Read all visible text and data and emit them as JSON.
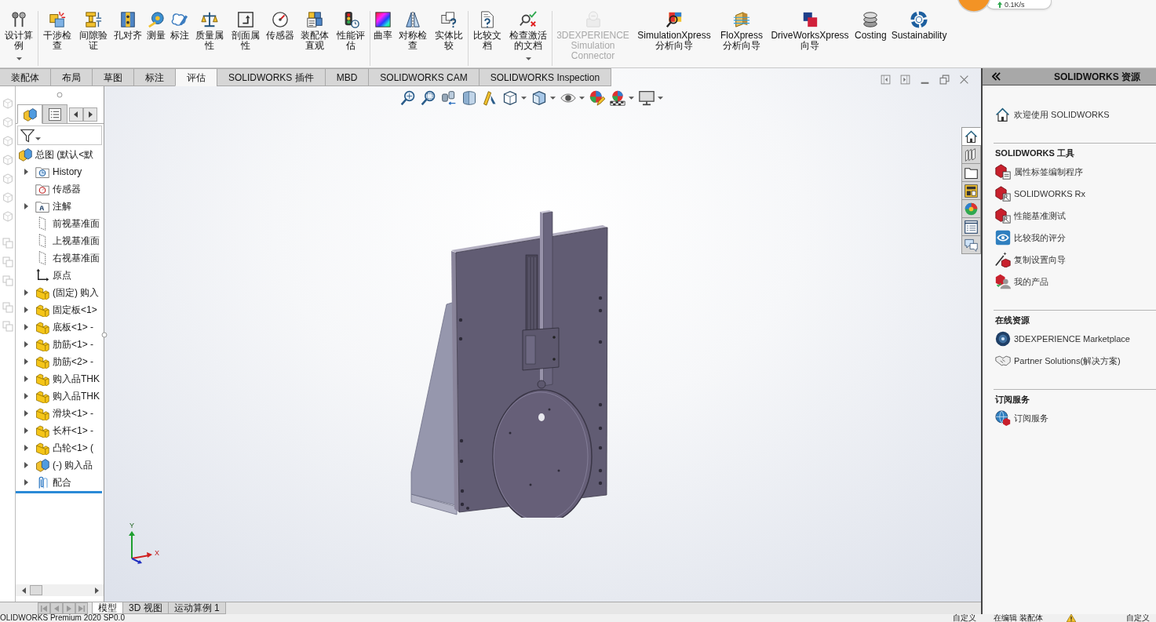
{
  "network_widget": {
    "speed": "0.1K/s"
  },
  "ribbon": {
    "groups": [
      {
        "buttons": [
          {
            "label": "设计算例",
            "dropdown": true,
            "disabled": false
          }
        ]
      },
      {
        "buttons": [
          {
            "label": "干涉检查",
            "dropdown": false,
            "disabled": false
          },
          {
            "label": "间隙验证",
            "dropdown": false,
            "disabled": false
          },
          {
            "label": "孔对齐",
            "dropdown": false,
            "disabled": false
          },
          {
            "label": "测量",
            "dropdown": false,
            "disabled": false
          },
          {
            "label": "标注",
            "dropdown": false,
            "disabled": false
          },
          {
            "label": "质量属性",
            "dropdown": false,
            "disabled": false
          },
          {
            "label": "剖面属性",
            "dropdown": false,
            "disabled": false
          },
          {
            "label": "传感器",
            "dropdown": false,
            "disabled": false
          },
          {
            "label": "装配体直观",
            "dropdown": false,
            "disabled": false
          },
          {
            "label": "性能评估",
            "dropdown": false,
            "disabled": false
          }
        ]
      },
      {
        "buttons": [
          {
            "label": "曲率",
            "dropdown": false,
            "disabled": false
          },
          {
            "label": "对称检查",
            "dropdown": false,
            "disabled": false
          },
          {
            "label": "实体比较",
            "dropdown": false,
            "disabled": false
          }
        ]
      },
      {
        "buttons": [
          {
            "label": "比较文档",
            "dropdown": false,
            "disabled": false
          },
          {
            "label": "检查激活的文档",
            "dropdown": true,
            "disabled": false
          }
        ]
      },
      {
        "buttons": [
          {
            "label": "3DEXPERIENCE Simulation Connector",
            "dropdown": false,
            "disabled": true
          },
          {
            "label": "SimulationXpress 分析向导",
            "dropdown": false,
            "disabled": false
          },
          {
            "label": "FloXpress 分析向导",
            "dropdown": false,
            "disabled": false
          },
          {
            "label": "DriveWorksXpress 向导",
            "dropdown": false,
            "disabled": false
          },
          {
            "label": "Costing",
            "dropdown": false,
            "disabled": false
          },
          {
            "label": "Sustainability",
            "dropdown": false,
            "disabled": false
          }
        ]
      }
    ]
  },
  "command_tabs": [
    {
      "label": "装配体",
      "selected": false
    },
    {
      "label": "布局",
      "selected": false
    },
    {
      "label": "草图",
      "selected": false
    },
    {
      "label": "标注",
      "selected": false
    },
    {
      "label": "评估",
      "selected": true
    },
    {
      "label": "SOLIDWORKS 插件",
      "selected": false
    },
    {
      "label": "MBD",
      "selected": false
    },
    {
      "label": "SOLIDWORKS CAM",
      "selected": false
    },
    {
      "label": "SOLIDWORKS Inspection",
      "selected": false
    }
  ],
  "feature_manager": {
    "panel_tabs": [
      {
        "selected": true
      },
      {
        "selected": false
      }
    ],
    "tree": {
      "label": "总图 (默认<默",
      "kind": "assembly",
      "children": [
        {
          "label": "History",
          "kind": "history",
          "expanded": false
        },
        {
          "label": "传感器",
          "kind": "sensor_folder"
        },
        {
          "label": "注解",
          "kind": "annotation_folder",
          "expanded": false
        },
        {
          "label": "前视基准面",
          "kind": "plane"
        },
        {
          "label": "上视基准面",
          "kind": "plane"
        },
        {
          "label": "右视基准面",
          "kind": "plane"
        },
        {
          "label": "原点",
          "kind": "origin"
        },
        {
          "label": "(固定) 购入",
          "kind": "part",
          "expanded": false
        },
        {
          "label": "固定板<1>",
          "kind": "part",
          "expanded": false
        },
        {
          "label": "底板<1> -",
          "kind": "part",
          "expanded": false
        },
        {
          "label": "肋筋<1> -",
          "kind": "part",
          "expanded": false
        },
        {
          "label": "肋筋<2> -",
          "kind": "part",
          "expanded": false
        },
        {
          "label": "购入品THK",
          "kind": "part",
          "expanded": false
        },
        {
          "label": "购入品THK",
          "kind": "part",
          "expanded": false
        },
        {
          "label": "滑块<1> -",
          "kind": "part",
          "expanded": false
        },
        {
          "label": "长杆<1> -",
          "kind": "part",
          "expanded": false
        },
        {
          "label": "凸轮<1> (",
          "kind": "part",
          "expanded": false
        },
        {
          "label": "(-) 购入品",
          "kind": "subassembly",
          "expanded": false
        },
        {
          "label": "配合",
          "kind": "mates",
          "expanded": false
        }
      ]
    }
  },
  "viewport": {
    "triad": {
      "y_label": "Y",
      "x_label": "X"
    }
  },
  "bottom_tabs": [
    {
      "label": "模型",
      "selected": true
    },
    {
      "label": "3D 视图",
      "selected": false
    },
    {
      "label": "运动算例 1",
      "selected": false
    }
  ],
  "task_pane": {
    "title": "SOLIDWORKS 资源",
    "side_tabs": [
      {
        "selected": true
      },
      {
        "selected": false
      },
      {
        "selected": false
      },
      {
        "selected": false
      },
      {
        "selected": false
      },
      {
        "selected": false
      },
      {
        "selected": false
      }
    ],
    "welcome": "欢迎使用 SOLIDWORKS",
    "sections": [
      {
        "title": "SOLIDWORKS 工具",
        "items": [
          "属性标签编制程序",
          "SOLIDWORKS Rx",
          "性能基准测试",
          "比较我的评分",
          "复制设置向导",
          "我的产品"
        ]
      },
      {
        "title": "在线资源",
        "items": [
          "3DEXPERIENCE Marketplace",
          "Partner Solutions(解决方案)"
        ]
      },
      {
        "title": "订阅服务",
        "items": [
          "订阅服务"
        ]
      }
    ]
  },
  "status_bar": {
    "version": "OLIDWORKS Premium 2020 SP0.0",
    "items": [
      "自定义",
      "在编辑 装配体",
      "自定义"
    ]
  }
}
